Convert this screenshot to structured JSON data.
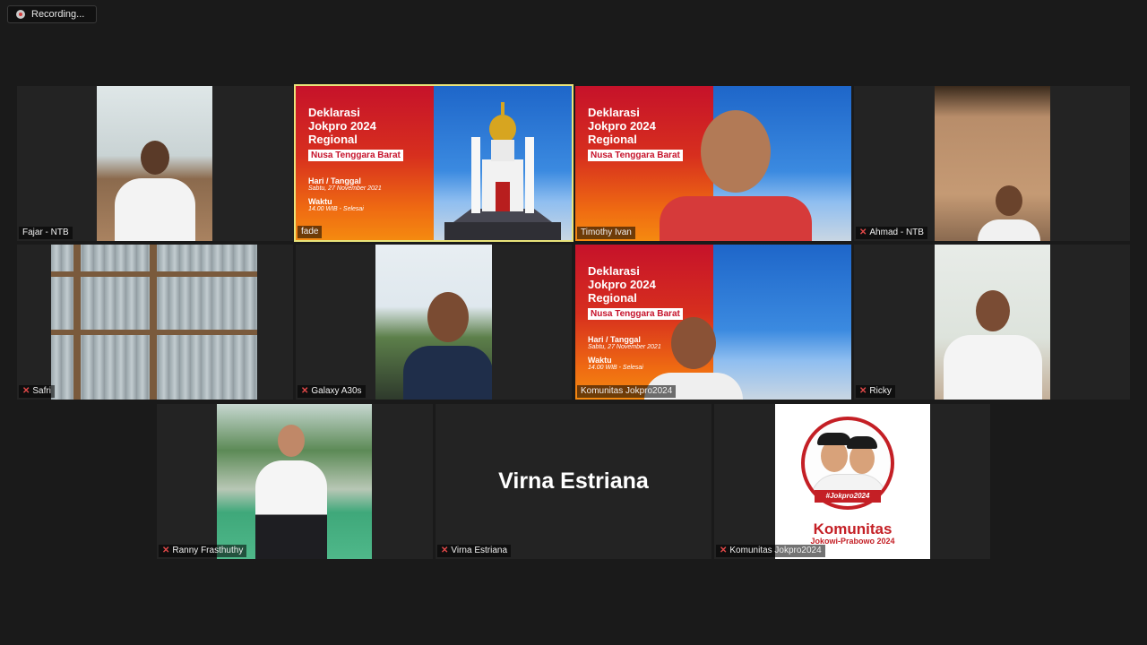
{
  "recording": {
    "label": "Recording..."
  },
  "slide": {
    "title_line1": "Deklarasi",
    "title_line2": "Jokpro 2024",
    "title_line3": "Regional",
    "region": "Nusa Tenggara Barat",
    "date_label": "Hari / Tanggal",
    "date_value": "Sabtu, 27 November 2021",
    "time_label": "Waktu",
    "time_value": "14.00 WIB - Selesai"
  },
  "participants": [
    {
      "name": "Fajar - NTB",
      "muted": false
    },
    {
      "name": "fade",
      "muted": false
    },
    {
      "name": "Timothy Ivan",
      "muted": false
    },
    {
      "name": "Ahmad - NTB",
      "muted": true
    },
    {
      "name": "Safri",
      "muted": true
    },
    {
      "name": "Galaxy A30s",
      "muted": true
    },
    {
      "name": "Komunitas Jokpro2024",
      "muted": false
    },
    {
      "name": "Ricky",
      "muted": true
    },
    {
      "name": "Ranny Frasthuthy",
      "muted": true
    },
    {
      "name": "Virna Estriana",
      "muted": true
    },
    {
      "name": "Komunitas Jokpro2024",
      "muted": true
    }
  ],
  "logo": {
    "tag": "#Jokpro2024",
    "brand": "Komunitas",
    "sub": "Jokowi-Prabowo 2024"
  },
  "colors": {
    "active_border": "#e9e37a",
    "muted_mic": "#e04848",
    "brand_red": "#c41f25"
  }
}
